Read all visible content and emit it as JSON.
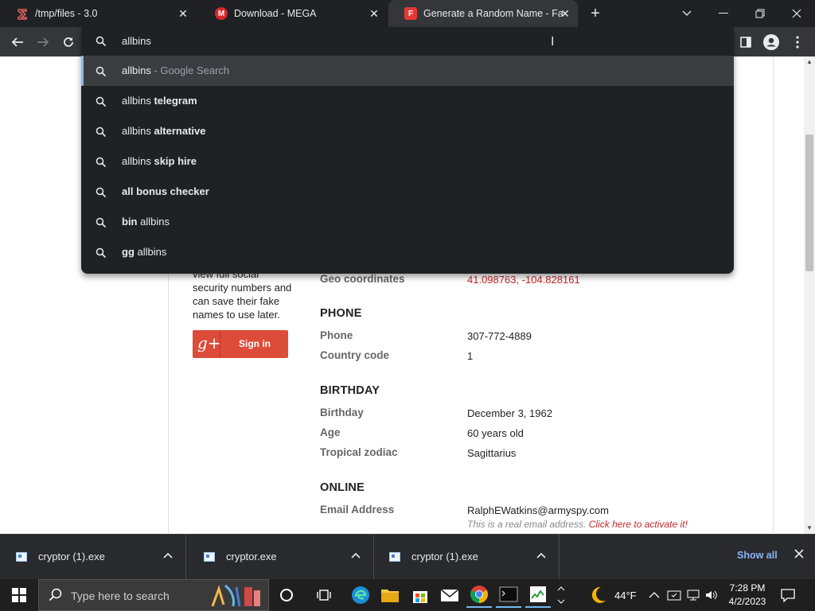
{
  "tabs": [
    {
      "title": "/tmp/files - 3.0",
      "favicon_color": "#1a1a1a",
      "favicon_glyph": "ʒ"
    },
    {
      "title": "Download - MEGA",
      "favicon_color": "#d9272e",
      "favicon_glyph": "M"
    },
    {
      "title": "Generate a Random Name - Fake",
      "favicon_color": "#e53935",
      "favicon_glyph": "F"
    }
  ],
  "omnibox": {
    "query": "allbins",
    "suggestions": [
      {
        "prefix": "allbins",
        "suffix": "",
        "hint": " - Google Search"
      },
      {
        "prefix": "allbins ",
        "suffix": "telegram",
        "hint": ""
      },
      {
        "prefix": "allbins ",
        "suffix": "alternative",
        "hint": ""
      },
      {
        "prefix": "allbins ",
        "suffix": "skip hire",
        "hint": ""
      },
      {
        "prefix": "",
        "suffix": "all bonus checker",
        "hint": ""
      },
      {
        "prefix": "bin",
        "suffix": " allbins",
        "hint": "",
        "bold_prefix": true
      },
      {
        "prefix": "gg",
        "suffix": " allbins",
        "hint": "",
        "bold_prefix": true
      }
    ]
  },
  "page": {
    "sidebar_lines": [
      "view full social",
      "security numbers and",
      "can save their fake",
      "names to use later."
    ],
    "signin_label": "Sign in",
    "gplus_glyph": "g+",
    "geo_label": "Geo coordinates",
    "geo_value": "41.098763, -104.828161",
    "phone_section": "PHONE",
    "phone_label": "Phone",
    "phone_value": "307-772-4889",
    "country_code_label": "Country code",
    "country_code_value": "1",
    "birthday_section": "BIRTHDAY",
    "birthday_label": "Birthday",
    "birthday_value": "December 3, 1962",
    "age_label": "Age",
    "age_value": "60 years old",
    "zodiac_label": "Tropical zodiac",
    "zodiac_value": "Sagittarius",
    "online_section": "ONLINE",
    "email_label": "Email Address",
    "email_value": "RalphEWatkins@armyspy.com",
    "email_note": "This is a real email address. ",
    "email_link": "Click here to activate it!"
  },
  "downloads": [
    {
      "name": "cryptor (1).exe"
    },
    {
      "name": "cryptor.exe"
    },
    {
      "name": "cryptor (1).exe"
    }
  ],
  "show_all": "Show all",
  "taskbar": {
    "search_placeholder": "Type here to search",
    "weather": "44°F",
    "time": "7:28 PM",
    "date": "4/2/2023"
  }
}
